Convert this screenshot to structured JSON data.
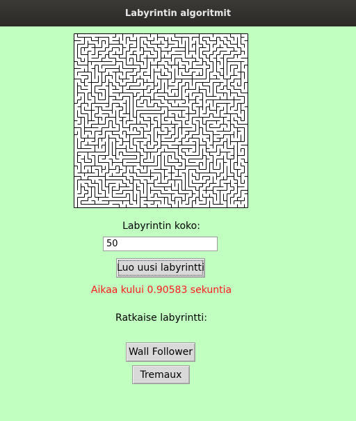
{
  "window": {
    "title": "Labyrintin algoritmit"
  },
  "maze": {
    "grid_size": 50
  },
  "controls": {
    "size_label": "Labyrintin koko:",
    "size_value": "50",
    "new_maze_button": "Luo uusi labyrintti",
    "status_text": "Aikaa kului 0.90583 sekuntia",
    "solve_label": "Ratkaise labyrintti:",
    "wall_follower_button": "Wall Follower",
    "tremaux_button": "Tremaux"
  },
  "colors": {
    "background": "#c0ffc0",
    "status": "#ff1a1a",
    "maze_wall": "#000000"
  }
}
